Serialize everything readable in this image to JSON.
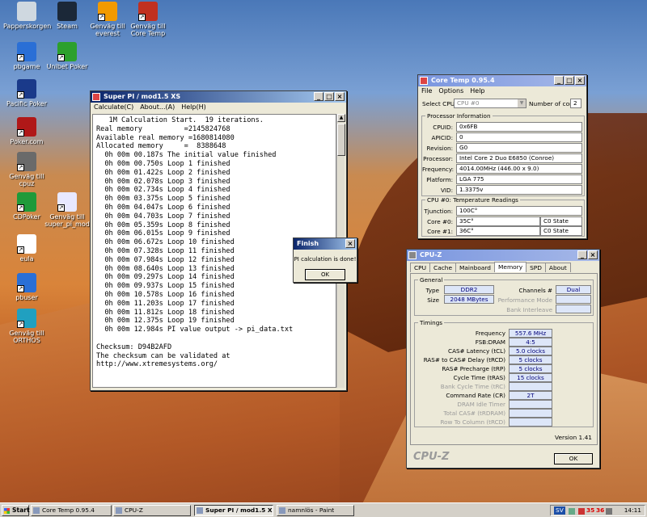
{
  "desktop": {
    "icons": [
      {
        "label": "Papperskorgen",
        "icon": "recycle-bin-icon",
        "color": "#cfd8e0"
      },
      {
        "label": "Steam",
        "icon": "steam-icon",
        "color": "#1b2838"
      },
      {
        "label": "Genväg till everest",
        "icon": "everest-icon",
        "color": "#f29a00"
      },
      {
        "label": "Genväg till Core Temp",
        "icon": "core-temp-icon",
        "color": "#c03020"
      },
      {
        "label": "pbgame",
        "icon": "ie-icon",
        "color": "#2a6fd6"
      },
      {
        "label": "Unibet Poker",
        "icon": "unibet-icon",
        "color": "#2ca02c"
      },
      {
        "label": "Pacific Poker",
        "icon": "pacific-poker-icon",
        "color": "#1a3a8a"
      },
      {
        "label": "Poker.com",
        "icon": "poker-com-icon",
        "color": "#b01818"
      },
      {
        "label": "Genväg till cpuz",
        "icon": "cpuz-icon",
        "color": "#6a6a6a"
      },
      {
        "label": "CDPoker",
        "icon": "cdpoker-icon",
        "color": "#1f9a3a"
      },
      {
        "label": "Genväg till super_pi_mod",
        "icon": "super-pi-icon",
        "color": "#e8e8ff"
      },
      {
        "label": "eula",
        "icon": "text-file-icon",
        "color": "#ffffff"
      },
      {
        "label": "pbuser",
        "icon": "ie-icon",
        "color": "#2a6fd6"
      },
      {
        "label": "Genväg till ORTHOS",
        "icon": "orthos-icon",
        "color": "#20a0c0"
      }
    ]
  },
  "superpi": {
    "title": "Super PI / mod1.5 XS",
    "menu": [
      "Calculate(C)",
      "About...(A)",
      "Help(H)"
    ],
    "output": "   1M Calculation Start.  19 iterations.\nReal memory          =2145824768\nAvailable real memory =1680814080\nAllocated memory     =  8388648\n  0h 00m 00.187s The initial value finished\n  0h 00m 00.750s Loop 1 finished\n  0h 00m 01.422s Loop 2 finished\n  0h 00m 02.078s Loop 3 finished\n  0h 00m 02.734s Loop 4 finished\n  0h 00m 03.375s Loop 5 finished\n  0h 00m 04.047s Loop 6 finished\n  0h 00m 04.703s Loop 7 finished\n  0h 00m 05.359s Loop 8 finished\n  0h 00m 06.015s Loop 9 finished\n  0h 00m 06.672s Loop 10 finished\n  0h 00m 07.328s Loop 11 finished\n  0h 00m 07.984s Loop 12 finished\n  0h 00m 08.640s Loop 13 finished\n  0h 00m 09.297s Loop 14 finished\n  0h 00m 09.937s Loop 15 finished\n  0h 00m 10.578s Loop 16 finished\n  0h 00m 11.203s Loop 17 finished\n  0h 00m 11.812s Loop 18 finished\n  0h 00m 12.375s Loop 19 finished\n  0h 00m 12.984s PI value output -> pi_data.txt\n\nChecksum: D94B2AFD\nThe checksum can be validated at\nhttp://www.xtremesystems.org/"
  },
  "finish_dialog": {
    "title": "Finish",
    "message": "PI calculation is done!",
    "ok": "OK"
  },
  "coretemp": {
    "title": "Core Temp 0.95.4",
    "menu": [
      "File",
      "Options",
      "Help"
    ],
    "select_cpu_label": "Select CPU:",
    "select_cpu_value": "CPU #0",
    "num_cores_label": "Number of cores",
    "num_cores_value": "2",
    "proc_info_title": "Processor Information",
    "fields": [
      {
        "label": "CPUID:",
        "value": "0x6FB"
      },
      {
        "label": "APICID:",
        "value": "0"
      },
      {
        "label": "Revision:",
        "value": "G0"
      },
      {
        "label": "Processor:",
        "value": "Intel Core 2 Duo E6850 (Conroe)"
      },
      {
        "label": "Frequency:",
        "value": "4014.00MHz (446.00 x 9.0)"
      },
      {
        "label": "Platform:",
        "value": "LGA 775"
      },
      {
        "label": "VID:",
        "value": "1.3375v"
      }
    ],
    "temp_title": "CPU #0: Temperature Readings",
    "tjunction_label": "Tjunction:",
    "tjunction_value": "100C°",
    "cores": [
      {
        "label": "Core #0:",
        "temp": "35C°",
        "state": "C0 State"
      },
      {
        "label": "Core #1:",
        "temp": "36C°",
        "state": "C0 State"
      }
    ]
  },
  "cpuz": {
    "title": "CPU-Z",
    "tabs": [
      "CPU",
      "Cache",
      "Mainboard",
      "Memory",
      "SPD",
      "About"
    ],
    "active_tab": "Memory",
    "general_title": "General",
    "type_label": "Type",
    "type_value": "DDR2",
    "size_label": "Size",
    "size_value": "2048 MBytes",
    "channels_label": "Channels #",
    "channels_value": "Dual",
    "perf_mode_label": "Performance Mode",
    "bank_interleave_label": "Bank Interleave",
    "timings_title": "Timings",
    "timings": [
      {
        "label": "Frequency",
        "value": "557.6 MHz",
        "enabled": true
      },
      {
        "label": "FSB:DRAM",
        "value": "4:5",
        "enabled": true
      },
      {
        "label": "CAS# Latency (tCL)",
        "value": "5.0 clocks",
        "enabled": true
      },
      {
        "label": "RAS# to CAS# Delay (tRCD)",
        "value": "5 clocks",
        "enabled": true
      },
      {
        "label": "RAS# Precharge (tRP)",
        "value": "5 clocks",
        "enabled": true
      },
      {
        "label": "Cycle Time (tRAS)",
        "value": "15 clocks",
        "enabled": true
      },
      {
        "label": "Bank Cycle Time (tRC)",
        "value": "",
        "enabled": false
      },
      {
        "label": "Command Rate (CR)",
        "value": "2T",
        "enabled": true
      },
      {
        "label": "DRAM Idle Timer",
        "value": "",
        "enabled": false
      },
      {
        "label": "Total CAS# (tRDRAM)",
        "value": "",
        "enabled": false
      },
      {
        "label": "Row To Column (tRCD)",
        "value": "",
        "enabled": false
      }
    ],
    "version": "Version 1.41",
    "logo": "CPU-Z",
    "ok": "OK"
  },
  "taskbar": {
    "start": "Start",
    "tasks": [
      {
        "label": "Core Temp 0.95.4",
        "active": false
      },
      {
        "label": "CPU-Z",
        "active": false
      },
      {
        "label": "Super PI / mod1.5 XS",
        "active": true
      },
      {
        "label": "namnlös - Paint",
        "active": false
      }
    ],
    "tray_lang": "SV",
    "tray_temp0": "35",
    "tray_temp1": "36",
    "clock": "14:11"
  }
}
